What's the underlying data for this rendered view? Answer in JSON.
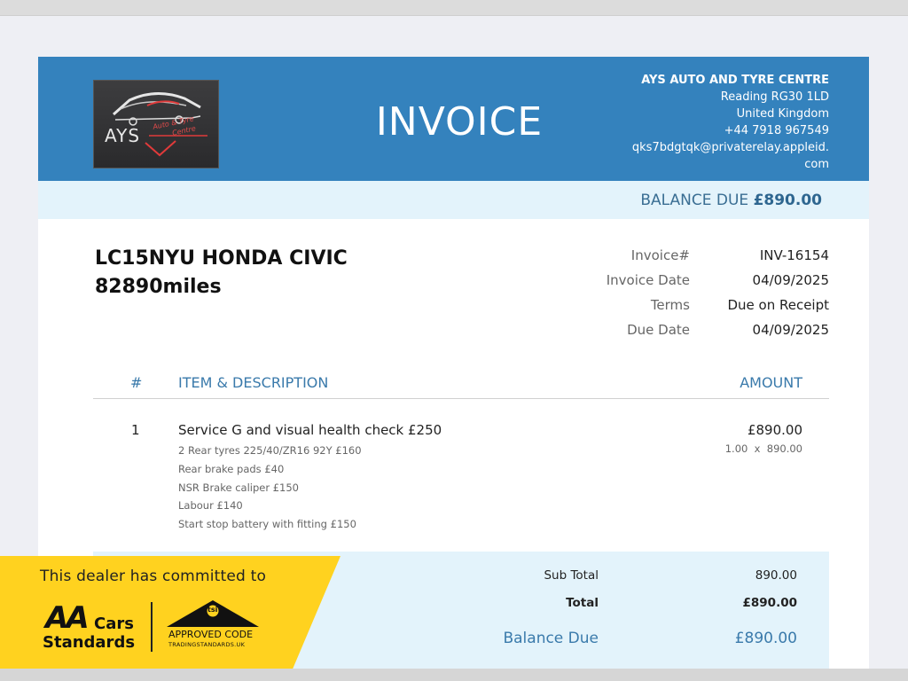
{
  "company": {
    "name": "AYS AUTO AND TYRE CENTRE",
    "address1": "Reading RG30 1LD",
    "address2": "United Kingdom",
    "phone": "+44 7918 967549",
    "email1": "qks7bdgtqk@privaterelay.appleid.",
    "email2": "com",
    "logo_text": "AYS",
    "logo_sub1": "Auto & Tyre",
    "logo_sub2": "Centre"
  },
  "document": {
    "title": "INVOICE",
    "balance_label": "BALANCE DUE",
    "balance_amount": "£890.00"
  },
  "vehicle": {
    "line1": "LC15NYU HONDA CIVIC",
    "line2": "82890miles"
  },
  "meta": [
    {
      "label": "Invoice#",
      "value": "INV-16154"
    },
    {
      "label": "Invoice Date",
      "value": "04/09/2025"
    },
    {
      "label": "Terms",
      "value": "Due on Receipt"
    },
    {
      "label": "Due Date",
      "value": "04/09/2025"
    }
  ],
  "table": {
    "headers": {
      "num": "#",
      "item": "ITEM & DESCRIPTION",
      "amount": "AMOUNT"
    },
    "rows": [
      {
        "num": "1",
        "title": "Service G and visual health check £250",
        "description": [
          "2 Rear tyres 225/40/ZR16 92Y £160",
          "Rear brake pads £40",
          "NSR Brake caliper £150",
          "Labour £140",
          "Start stop battery with fitting £150"
        ],
        "amount": "£890.00",
        "qty_rate": "1.00  x  890.00"
      }
    ]
  },
  "totals": {
    "subtotal_label": "Sub Total",
    "subtotal_value": "890.00",
    "total_label": "Total",
    "total_value": "£890.00",
    "balance_label": "Balance Due",
    "balance_value": "£890.00"
  },
  "banner": {
    "text": "This dealer has committed to",
    "aa_logo": "AA",
    "aa_cars": "Cars",
    "aa_standards": "Standards",
    "tsi_logo": "tsi",
    "approved_code": "APPROVED CODE",
    "trading_standards": "TRADINGSTANDARDS.UK"
  },
  "colors": {
    "header_blue": "#3482bd",
    "light_band": "#e3f3fb",
    "banner_yellow": "#ffd21f",
    "accent_text": "#3a7aab"
  }
}
